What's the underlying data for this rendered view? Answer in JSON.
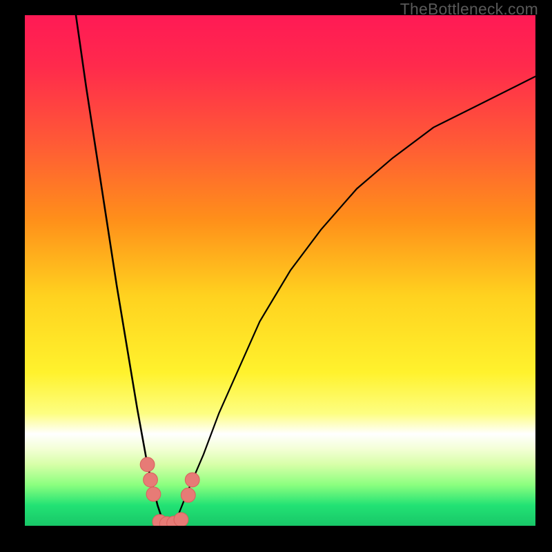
{
  "watermark": "TheBottleneck.com",
  "gradient_stops": [
    {
      "offset": 0.0,
      "color": "#ff1a55"
    },
    {
      "offset": 0.1,
      "color": "#ff2a4c"
    },
    {
      "offset": 0.25,
      "color": "#ff5a36"
    },
    {
      "offset": 0.4,
      "color": "#ff8f1a"
    },
    {
      "offset": 0.55,
      "color": "#ffd21f"
    },
    {
      "offset": 0.7,
      "color": "#fff22d"
    },
    {
      "offset": 0.78,
      "color": "#fdfe81"
    },
    {
      "offset": 0.82,
      "color": "#ffffff"
    },
    {
      "offset": 0.85,
      "color": "#f3ffd5"
    },
    {
      "offset": 0.88,
      "color": "#d7ffa8"
    },
    {
      "offset": 0.92,
      "color": "#8bff7f"
    },
    {
      "offset": 0.96,
      "color": "#22e274"
    },
    {
      "offset": 1.0,
      "color": "#18c768"
    }
  ],
  "chart_data": {
    "type": "line",
    "title": "",
    "xlabel": "",
    "ylabel": "",
    "xlim": [
      0,
      100
    ],
    "ylim": [
      0,
      100
    ],
    "series": [
      {
        "name": "left-branch",
        "x": [
          10,
          12,
          14,
          16,
          18,
          20,
          22,
          24,
          25,
          26,
          27,
          28
        ],
        "values": [
          100,
          86,
          73,
          60,
          47,
          35,
          23,
          12,
          8,
          4,
          1,
          0
        ]
      },
      {
        "name": "right-branch",
        "x": [
          28,
          30,
          32,
          35,
          38,
          42,
          46,
          52,
          58,
          65,
          72,
          80,
          88,
          96,
          100
        ],
        "values": [
          0,
          2,
          7,
          14,
          22,
          31,
          40,
          50,
          58,
          66,
          72,
          78,
          82,
          86,
          88
        ]
      }
    ],
    "markers": [
      {
        "name": "dot-left-1",
        "x": 24.0,
        "y": 12.0
      },
      {
        "name": "dot-left-2",
        "x": 24.6,
        "y": 9.0
      },
      {
        "name": "dot-left-3",
        "x": 25.2,
        "y": 6.2
      },
      {
        "name": "dot-floor-1",
        "x": 26.4,
        "y": 0.8
      },
      {
        "name": "dot-floor-2",
        "x": 27.8,
        "y": 0.4
      },
      {
        "name": "dot-floor-3",
        "x": 29.2,
        "y": 0.5
      },
      {
        "name": "dot-floor-4",
        "x": 30.6,
        "y": 1.2
      },
      {
        "name": "dot-right-1",
        "x": 32.0,
        "y": 6.0
      },
      {
        "name": "dot-right-2",
        "x": 32.8,
        "y": 9.0
      }
    ],
    "marker_style": {
      "fill": "#e77b76",
      "stroke": "#d9635e",
      "r": 1.4
    }
  }
}
